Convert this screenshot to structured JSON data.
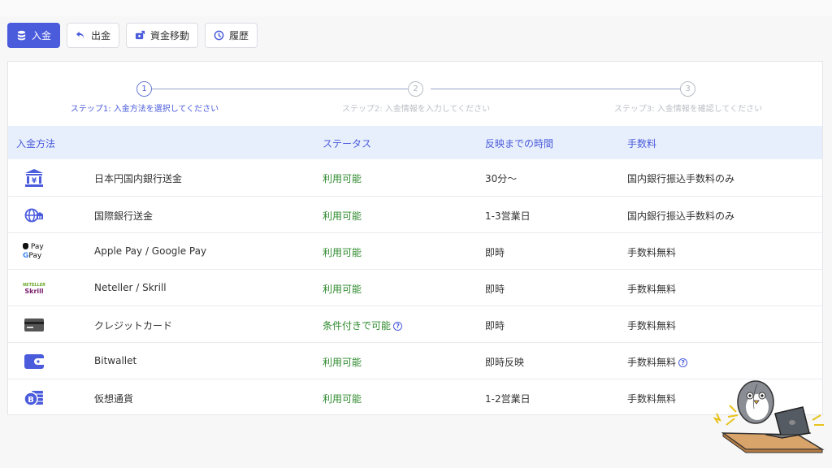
{
  "tabs": [
    {
      "label": "入金",
      "icon": "database-icon",
      "active": true
    },
    {
      "label": "出金",
      "icon": "undo-arrow-icon",
      "active": false
    },
    {
      "label": "資金移動",
      "icon": "transfer-icon",
      "active": false
    },
    {
      "label": "履歴",
      "icon": "history-icon",
      "active": false
    }
  ],
  "steps": [
    {
      "number": "1",
      "label": "ステップ1: 入金方法を選択してください"
    },
    {
      "number": "2",
      "label": "ステップ2: 入金情報を入力してください"
    },
    {
      "number": "3",
      "label": "ステップ3: 入金情報を確認してください"
    }
  ],
  "table": {
    "headers": {
      "method": "入金方法",
      "status": "ステータス",
      "time": "反映までの時間",
      "fee": "手数料"
    },
    "rows": [
      {
        "icon": "bank-yen-icon",
        "method": "日本円国内銀行送金",
        "status": "利用可能",
        "time": "30分〜",
        "fee": "国内銀行振込手数料のみ"
      },
      {
        "icon": "globe-bank-icon",
        "method": "国際銀行送金",
        "status": "利用可能",
        "time": "1-3営業日",
        "fee": "国内銀行振込手数料のみ"
      },
      {
        "icon": "apple-google-pay-icon",
        "method": "Apple Pay / Google Pay",
        "status": "利用可能",
        "time": "即時",
        "fee": "手数料無料"
      },
      {
        "icon": "neteller-skrill-icon",
        "method": "Neteller / Skrill",
        "status": "利用可能",
        "time": "即時",
        "fee": "手数料無料"
      },
      {
        "icon": "credit-card-icon",
        "method": "クレジットカード",
        "status": "条件付きで可能",
        "time": "即時",
        "fee": "手数料無料"
      },
      {
        "icon": "wallet-icon",
        "method": "Bitwallet",
        "status": "利用可能",
        "time": "即時反映",
        "fee": "手数料無料"
      },
      {
        "icon": "bitcoin-icon",
        "method": "仮想通貨",
        "status": "利用可能",
        "time": "1-2営業日",
        "fee": "手数料無料"
      }
    ]
  },
  "logos": {
    "pay_apple": "Pay",
    "pay_google": "Pay",
    "neteller": "NETELLER",
    "skrill": "Skrill"
  },
  "colors": {
    "accent": "#4a5bdc",
    "available": "#2e8a2e",
    "header_bg": "#e8effc"
  }
}
